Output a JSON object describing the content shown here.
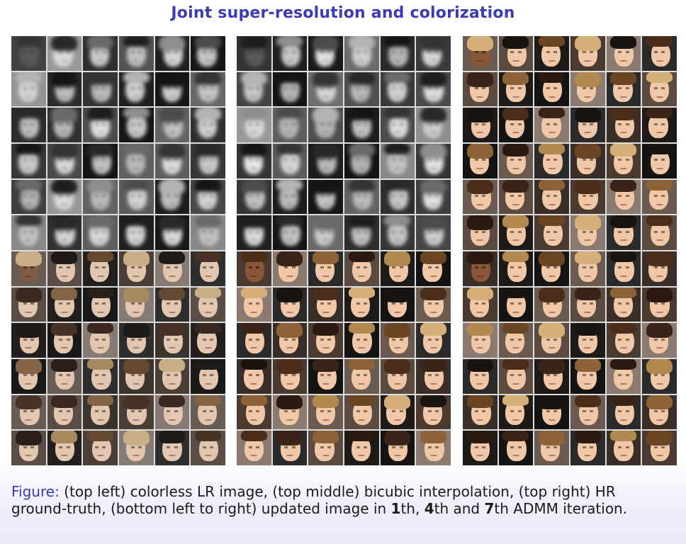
{
  "slide": {
    "title": "Joint super-resolution and colorization"
  },
  "figure_panels": [
    {
      "id": "left"
    },
    {
      "id": "middle"
    },
    {
      "id": "right"
    }
  ],
  "caption": {
    "label": "Figure:",
    "part1": " (top left) colorless LR image, (top middle) bicubic interpolation, (top right) HR ground-truth, (bottom left to right) updated image in ",
    "n1": "1",
    "part2": "th, ",
    "n2": "4",
    "part3": "th and ",
    "n3": "7",
    "part4": "th ADMM iteration."
  },
  "colors": {
    "title": "#3b3bb3",
    "figure_label": "#3b3bb3"
  }
}
